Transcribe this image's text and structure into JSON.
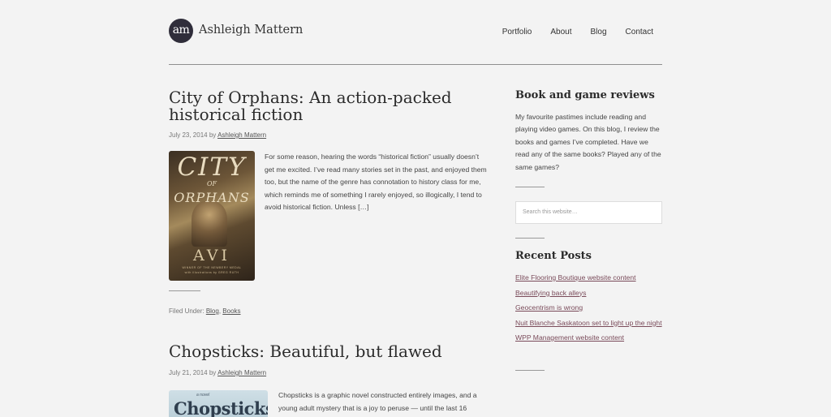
{
  "header": {
    "logo_text": "am",
    "site_title": "Ashleigh Mattern",
    "nav": [
      "Portfolio",
      "About",
      "Blog",
      "Contact"
    ]
  },
  "posts": [
    {
      "title": "City of Orphans: An action-packed historical fiction",
      "date": "July 23, 2014",
      "by": "by",
      "author": "Ashleigh Mattern",
      "cover": {
        "title_line1": "CITY",
        "title_line2": "OF",
        "title_line3": "ORPHANS",
        "author": "AVI",
        "small_line1": "WINNER OF THE NEWBERY MEDAL",
        "small_line2": "with illustrations by GREG RUTH"
      },
      "excerpt": "For some reason, hearing the words “historical fiction” usually doesn’t get me excited. I’ve read many stories set in the past, and enjoyed them too, but the name of the genre has connotation to history class for me, which reminds me of something I rarely enjoyed, so illogically, I tend to avoid historical fiction. Unless […]",
      "filed_under_label": "Filed Under:",
      "categories": [
        "Blog",
        "Books"
      ]
    },
    {
      "title": "Chopsticks: Beautiful, but flawed",
      "date": "July 21, 2014",
      "by": "by",
      "author": "Ashleigh Mattern",
      "cover": {
        "title": "Chopsticks",
        "small": "a novel"
      },
      "excerpt": "Chopsticks is a graphic novel constructed entirely images, and a young adult mystery that is a joy to peruse — until the last 16"
    }
  ],
  "sidebar": {
    "about_title": "Book and game reviews",
    "about_text": "My favourite pastimes include reading and playing video games. On this blog, I review the books and games I’ve completed. Have we read any of the same books? Played any of the same games?",
    "search_placeholder": "Search this website…",
    "recent_title": "Recent Posts",
    "recent_posts": [
      "Elite Flooring Boutique website content",
      "Beautifying back alleys",
      "Geocentrism is wrong",
      "Nuit Blanche Saskatoon set to light up the night",
      "WPP Management website content"
    ]
  }
}
